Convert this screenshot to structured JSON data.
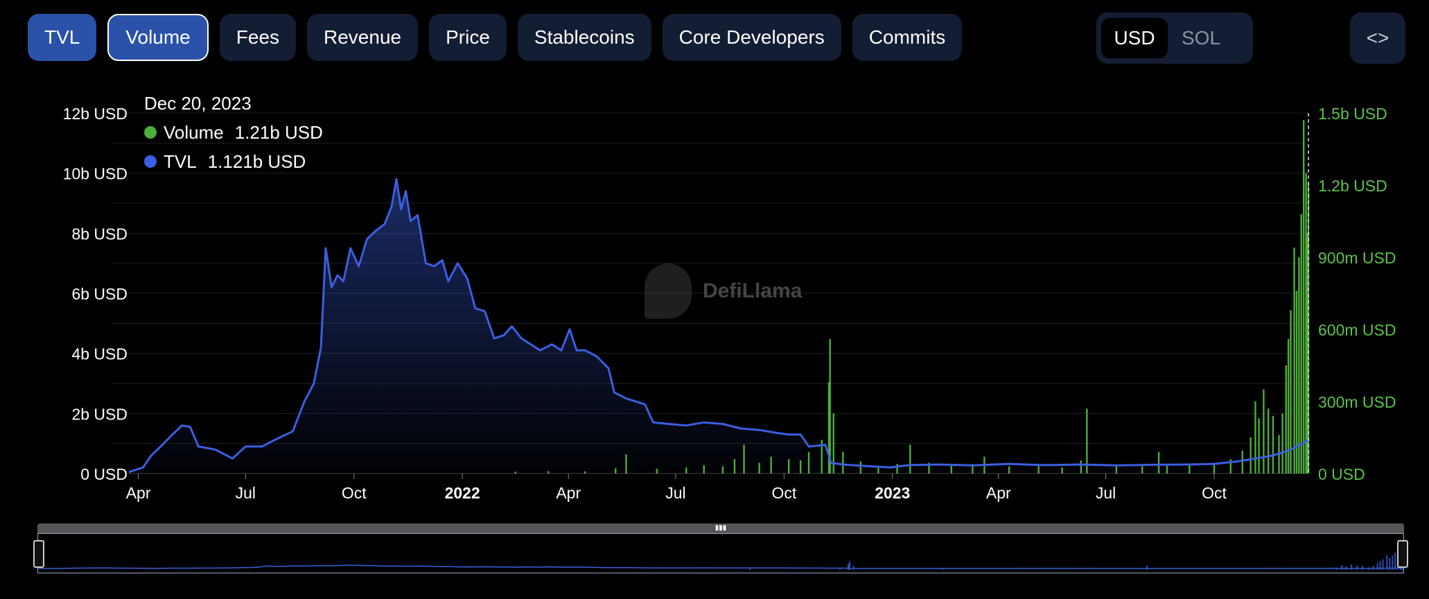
{
  "tabs": [
    {
      "label": "TVL",
      "state": "active"
    },
    {
      "label": "Volume",
      "state": "selected"
    },
    {
      "label": "Fees",
      "state": ""
    },
    {
      "label": "Revenue",
      "state": ""
    },
    {
      "label": "Price",
      "state": ""
    },
    {
      "label": "Stablecoins",
      "state": ""
    },
    {
      "label": "Core Developers",
      "state": ""
    },
    {
      "label": "Commits",
      "state": ""
    }
  ],
  "currency": {
    "options": [
      "USD",
      "SOL"
    ],
    "selected": "USD"
  },
  "embed_icon": "code-brackets-icon",
  "embed_label": "<>",
  "tooltip": {
    "date": "Dec 20, 2023",
    "items": [
      {
        "name": "Volume",
        "value": "1.21b USD",
        "color": "#4caf3a"
      },
      {
        "name": "TVL",
        "value": "1.121b USD",
        "color": "#3b5fe0"
      }
    ]
  },
  "watermark": "DefiLlama",
  "chart_data": {
    "type": "bar+line",
    "x_start": "2021-03-24",
    "x_end": "2023-12-20",
    "x_ticks": [
      {
        "date": "2021-04-01",
        "label": "Apr",
        "bold": false
      },
      {
        "date": "2021-07-01",
        "label": "Jul",
        "bold": false
      },
      {
        "date": "2021-10-01",
        "label": "Oct",
        "bold": false
      },
      {
        "date": "2022-01-01",
        "label": "2022",
        "bold": true
      },
      {
        "date": "2022-04-01",
        "label": "Apr",
        "bold": false
      },
      {
        "date": "2022-07-01",
        "label": "Jul",
        "bold": false
      },
      {
        "date": "2022-10-01",
        "label": "Oct",
        "bold": false
      },
      {
        "date": "2023-01-01",
        "label": "2023",
        "bold": true
      },
      {
        "date": "2023-04-01",
        "label": "Apr",
        "bold": false
      },
      {
        "date": "2023-07-01",
        "label": "Jul",
        "bold": false
      },
      {
        "date": "2023-10-01",
        "label": "Oct",
        "bold": false
      }
    ],
    "y_left": {
      "unit": "USD",
      "ylim": [
        0,
        12000000000
      ],
      "ticks": [
        {
          "v": 0,
          "label": "0 USD"
        },
        {
          "v": 2000000000,
          "label": "2b USD"
        },
        {
          "v": 4000000000,
          "label": "4b USD"
        },
        {
          "v": 6000000000,
          "label": "6b USD"
        },
        {
          "v": 8000000000,
          "label": "8b USD"
        },
        {
          "v": 10000000000,
          "label": "10b USD"
        },
        {
          "v": 12000000000,
          "label": "12b USD"
        }
      ]
    },
    "y_right": {
      "unit": "USD",
      "ylim": [
        0,
        1500000000
      ],
      "ticks": [
        {
          "v": 0,
          "label": "0 USD"
        },
        {
          "v": 300000000,
          "label": "300m USD"
        },
        {
          "v": 600000000,
          "label": "600m USD"
        },
        {
          "v": 900000000,
          "label": "900m USD"
        },
        {
          "v": 1200000000,
          "label": "1.2b USD"
        },
        {
          "v": 1500000000,
          "label": "1.5b USD"
        }
      ]
    },
    "series": [
      {
        "name": "TVL",
        "axis": "left",
        "type": "area",
        "color": "#3b5fe0",
        "points": [
          [
            "2021-03-24",
            0.05
          ],
          [
            "2021-04-05",
            0.2
          ],
          [
            "2021-04-12",
            0.6
          ],
          [
            "2021-04-20",
            0.9
          ],
          [
            "2021-04-30",
            1.3
          ],
          [
            "2021-05-08",
            1.6
          ],
          [
            "2021-05-15",
            1.55
          ],
          [
            "2021-05-22",
            0.9
          ],
          [
            "2021-06-05",
            0.8
          ],
          [
            "2021-06-20",
            0.5
          ],
          [
            "2021-07-01",
            0.9
          ],
          [
            "2021-07-15",
            0.9
          ],
          [
            "2021-07-30",
            1.2
          ],
          [
            "2021-08-10",
            1.4
          ],
          [
            "2021-08-20",
            2.4
          ],
          [
            "2021-08-28",
            3.0
          ],
          [
            "2021-09-03",
            4.2
          ],
          [
            "2021-09-07",
            7.5
          ],
          [
            "2021-09-12",
            6.2
          ],
          [
            "2021-09-17",
            6.6
          ],
          [
            "2021-09-22",
            6.4
          ],
          [
            "2021-09-28",
            7.5
          ],
          [
            "2021-10-05",
            6.9
          ],
          [
            "2021-10-12",
            7.8
          ],
          [
            "2021-10-20",
            8.1
          ],
          [
            "2021-10-27",
            8.3
          ],
          [
            "2021-11-02",
            8.9
          ],
          [
            "2021-11-06",
            9.8
          ],
          [
            "2021-11-10",
            8.8
          ],
          [
            "2021-11-14",
            9.4
          ],
          [
            "2021-11-18",
            8.4
          ],
          [
            "2021-11-24",
            8.6
          ],
          [
            "2021-12-01",
            7.0
          ],
          [
            "2021-12-08",
            6.9
          ],
          [
            "2021-12-15",
            7.1
          ],
          [
            "2021-12-20",
            6.4
          ],
          [
            "2021-12-28",
            7.0
          ],
          [
            "2022-01-05",
            6.5
          ],
          [
            "2022-01-12",
            5.5
          ],
          [
            "2022-01-20",
            5.4
          ],
          [
            "2022-01-28",
            4.5
          ],
          [
            "2022-02-05",
            4.6
          ],
          [
            "2022-02-12",
            4.9
          ],
          [
            "2022-02-20",
            4.5
          ],
          [
            "2022-02-28",
            4.3
          ],
          [
            "2022-03-08",
            4.1
          ],
          [
            "2022-03-18",
            4.3
          ],
          [
            "2022-03-26",
            4.1
          ],
          [
            "2022-04-02",
            4.8
          ],
          [
            "2022-04-08",
            4.1
          ],
          [
            "2022-04-15",
            4.1
          ],
          [
            "2022-04-25",
            3.9
          ],
          [
            "2022-05-05",
            3.5
          ],
          [
            "2022-05-10",
            2.7
          ],
          [
            "2022-05-20",
            2.5
          ],
          [
            "2022-06-05",
            2.3
          ],
          [
            "2022-06-12",
            1.7
          ],
          [
            "2022-06-25",
            1.65
          ],
          [
            "2022-07-10",
            1.6
          ],
          [
            "2022-07-25",
            1.7
          ],
          [
            "2022-08-10",
            1.65
          ],
          [
            "2022-08-25",
            1.5
          ],
          [
            "2022-09-10",
            1.45
          ],
          [
            "2022-09-25",
            1.35
          ],
          [
            "2022-10-05",
            1.3
          ],
          [
            "2022-10-15",
            1.3
          ],
          [
            "2022-10-22",
            0.9
          ],
          [
            "2022-11-05",
            0.95
          ],
          [
            "2022-11-10",
            0.35
          ],
          [
            "2022-11-20",
            0.3
          ],
          [
            "2022-12-10",
            0.25
          ],
          [
            "2022-12-30",
            0.2
          ],
          [
            "2023-01-15",
            0.28
          ],
          [
            "2023-02-10",
            0.3
          ],
          [
            "2023-03-10",
            0.27
          ],
          [
            "2023-04-10",
            0.32
          ],
          [
            "2023-05-10",
            0.28
          ],
          [
            "2023-06-10",
            0.3
          ],
          [
            "2023-07-10",
            0.27
          ],
          [
            "2023-08-10",
            0.29
          ],
          [
            "2023-09-10",
            0.3
          ],
          [
            "2023-10-01",
            0.32
          ],
          [
            "2023-10-20",
            0.4
          ],
          [
            "2023-11-05",
            0.5
          ],
          [
            "2023-11-20",
            0.6
          ],
          [
            "2023-12-05",
            0.8
          ],
          [
            "2023-12-15",
            1.0
          ],
          [
            "2023-12-20",
            1.121
          ]
        ]
      },
      {
        "name": "Volume",
        "axis": "right",
        "type": "bar",
        "color": "#4caf3a",
        "unit": "m USD",
        "points": [
          [
            "2022-02-15",
            8
          ],
          [
            "2022-03-15",
            10
          ],
          [
            "2022-04-15",
            9
          ],
          [
            "2022-05-11",
            22
          ],
          [
            "2022-05-20",
            80
          ],
          [
            "2022-06-15",
            20
          ],
          [
            "2022-07-10",
            25
          ],
          [
            "2022-07-25",
            35
          ],
          [
            "2022-08-10",
            30
          ],
          [
            "2022-08-20",
            60
          ],
          [
            "2022-08-28",
            120
          ],
          [
            "2022-09-10",
            45
          ],
          [
            "2022-09-20",
            70
          ],
          [
            "2022-10-05",
            60
          ],
          [
            "2022-10-15",
            55
          ],
          [
            "2022-10-22",
            90
          ],
          [
            "2022-11-02",
            140
          ],
          [
            "2022-11-08",
            380
          ],
          [
            "2022-11-09",
            560
          ],
          [
            "2022-11-12",
            250
          ],
          [
            "2022-11-20",
            90
          ],
          [
            "2022-12-05",
            50
          ],
          [
            "2022-12-20",
            30
          ],
          [
            "2023-01-05",
            40
          ],
          [
            "2023-01-16",
            120
          ],
          [
            "2023-02-01",
            45
          ],
          [
            "2023-02-20",
            35
          ],
          [
            "2023-03-10",
            40
          ],
          [
            "2023-03-20",
            70
          ],
          [
            "2023-04-10",
            30
          ],
          [
            "2023-05-05",
            35
          ],
          [
            "2023-05-25",
            25
          ],
          [
            "2023-06-10",
            55
          ],
          [
            "2023-06-15",
            270
          ],
          [
            "2023-07-10",
            35
          ],
          [
            "2023-08-01",
            30
          ],
          [
            "2023-08-15",
            90
          ],
          [
            "2023-08-22",
            40
          ],
          [
            "2023-09-10",
            35
          ],
          [
            "2023-10-01",
            40
          ],
          [
            "2023-10-15",
            60
          ],
          [
            "2023-10-25",
            95
          ],
          [
            "2023-11-01",
            150
          ],
          [
            "2023-11-05",
            300
          ],
          [
            "2023-11-08",
            230
          ],
          [
            "2023-11-12",
            350
          ],
          [
            "2023-11-16",
            270
          ],
          [
            "2023-11-20",
            240
          ],
          [
            "2023-11-25",
            160
          ],
          [
            "2023-11-28",
            250
          ],
          [
            "2023-12-01",
            450
          ],
          [
            "2023-12-03",
            560
          ],
          [
            "2023-12-05",
            680
          ],
          [
            "2023-12-08",
            940
          ],
          [
            "2023-12-10",
            760
          ],
          [
            "2023-12-12",
            900
          ],
          [
            "2023-12-14",
            1080
          ],
          [
            "2023-12-16",
            1470
          ],
          [
            "2023-12-18",
            1250
          ],
          [
            "2023-12-19",
            1000
          ],
          [
            "2023-12-20",
            1210
          ]
        ]
      }
    ]
  }
}
